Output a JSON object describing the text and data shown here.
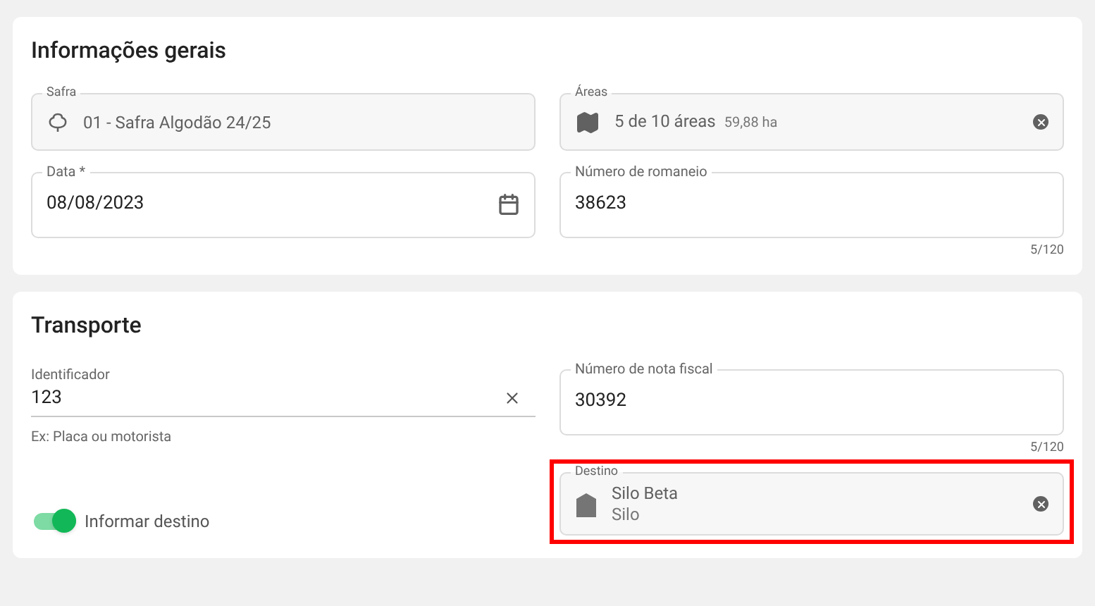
{
  "sections": [
    {
      "title": "Informações gerais",
      "fields": [
        {
          "kind": "select",
          "label": "Safra",
          "value": "01 - Safra Algodão 24/25",
          "disabled": true
        },
        {
          "kind": "select",
          "label": "Áreas",
          "value": "5 de 10 áreas",
          "extra": "59,88 ha",
          "disabled": true,
          "clearable": true
        },
        {
          "kind": "date",
          "label": "Data *",
          "value": "08/08/2023"
        },
        {
          "kind": "text",
          "label": "Número de romaneio",
          "value": "38623",
          "counter": "5/120"
        }
      ]
    },
    {
      "title": "Transporte",
      "fields": [
        {
          "kind": "underline",
          "label": "Identificador",
          "value": "123",
          "hint": "Ex: Placa ou motorista"
        },
        {
          "kind": "text",
          "label": "Número de nota fiscal",
          "value": "30392",
          "counter": "5/120"
        },
        {
          "kind": "toggle",
          "label": "Informar destino",
          "on": true
        },
        {
          "kind": "select",
          "label": "Destino",
          "value": "Silo Beta",
          "sub": "Silo",
          "disabled": true,
          "clearable": true,
          "highlighted": true
        }
      ]
    }
  ]
}
